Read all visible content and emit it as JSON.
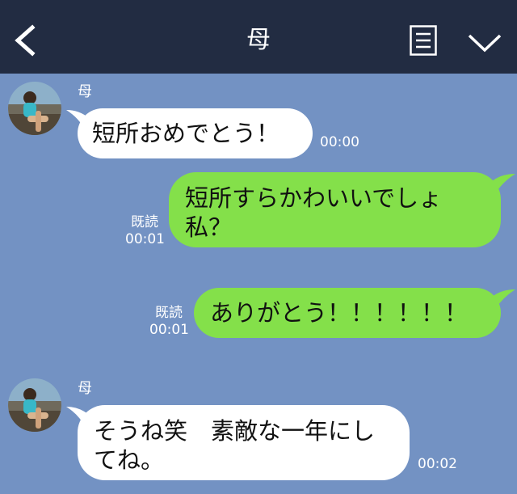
{
  "header": {
    "title": "母"
  },
  "messages": [
    {
      "side": "in",
      "sender": "母",
      "text": "短所おめでとう！",
      "time": "00:00"
    },
    {
      "side": "out",
      "text": "短所すらかわいいでしょ私？",
      "read": "既読",
      "time": "00:01"
    },
    {
      "side": "out",
      "text": "ありがとう！！！！！！",
      "read": "既読",
      "time": "00:01"
    },
    {
      "side": "in",
      "sender": "母",
      "text": "そうね笑　素敵な一年にしてね。",
      "time": "00:02"
    }
  ],
  "colors": {
    "header_bg": "#222c42",
    "chat_bg": "#7392c3",
    "outgoing_bubble": "#84e04a",
    "incoming_bubble": "#ffffff"
  }
}
